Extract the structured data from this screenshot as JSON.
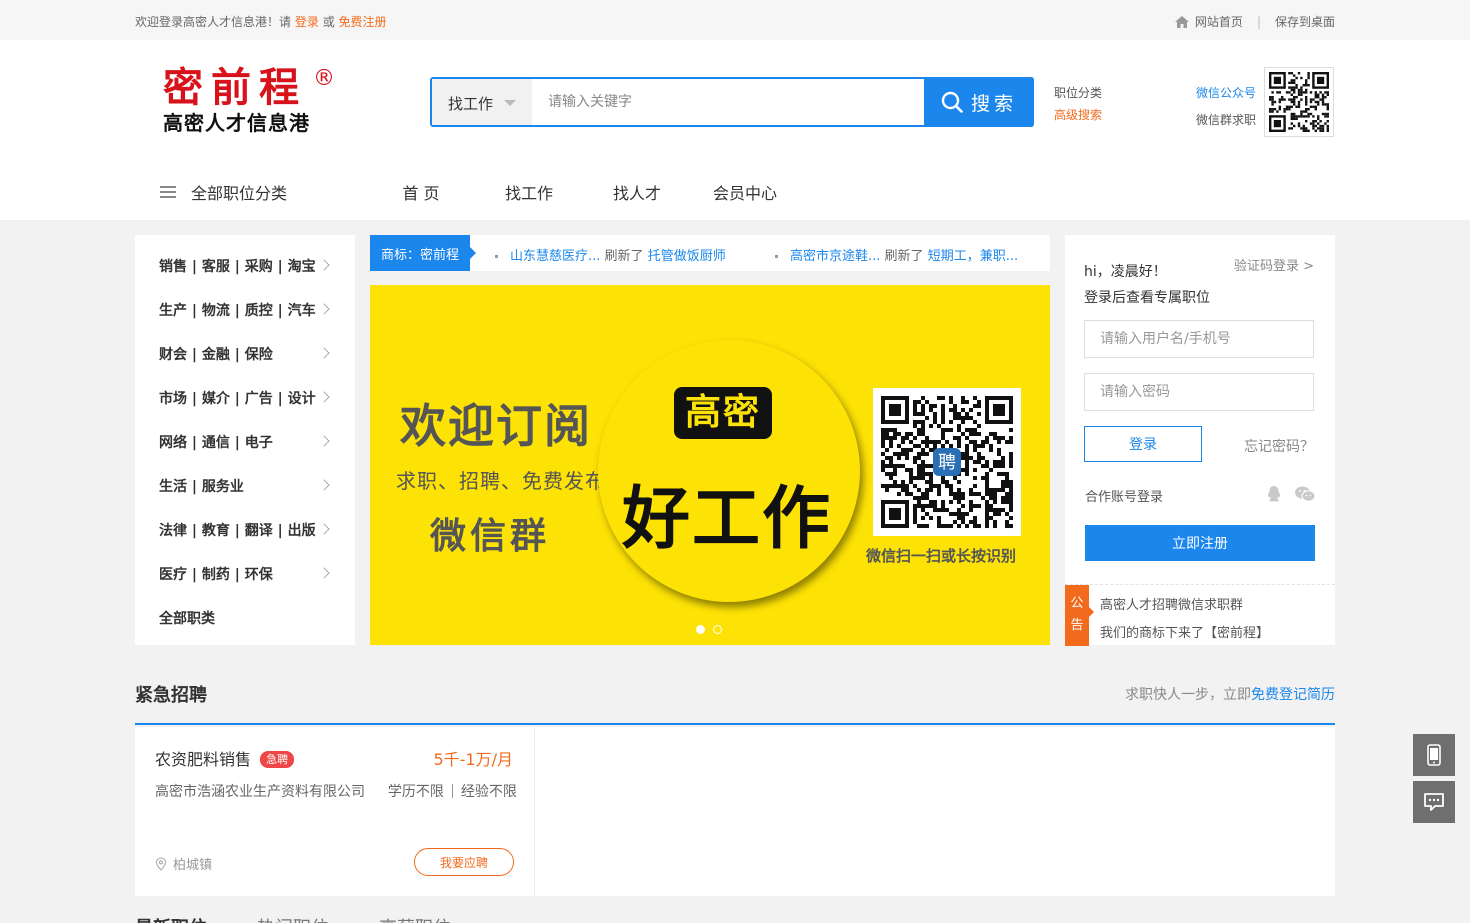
{
  "topbar": {
    "welcome_prefix": "欢迎登录高密人才信息港！请",
    "login_link": "登录",
    "or": "或",
    "register_link": "免费注册",
    "home_link": "网站首页",
    "separator": "|",
    "save_desktop": "保存到桌面"
  },
  "logo": {
    "main": "密前程",
    "reg_mark": "®",
    "sub": "高密人才信息港"
  },
  "search": {
    "type_label": "找工作",
    "placeholder": "请输入关键字",
    "button_label": "搜索"
  },
  "side_links": {
    "category": "职位分类",
    "advanced": "高级搜索"
  },
  "wechat": {
    "official": "微信公众号",
    "group": "微信群求职"
  },
  "nav": {
    "all_categories": "全部职位分类",
    "items": [
      "首 页",
      "找工作",
      "找人才",
      "会员中心"
    ]
  },
  "categories": [
    "销售 | 客服 | 采购 | 淘宝",
    "生产 | 物流 | 质控 | 汽车",
    "财会 | 金融 | 保险",
    "市场 | 媒介 | 广告 | 设计",
    "网络 | 通信 | 电子",
    "生活 | 服务业",
    "法律 | 教育 | 翻译 | 出版",
    "医疗 | 制药 | 环保",
    "全部职类"
  ],
  "ticker": {
    "tag": "商标：密前程",
    "items": [
      {
        "company": "山东慧慈医疗...",
        "action": "刷新了",
        "job": "托管做饭厨师"
      },
      {
        "company": "高密市京途鞋...",
        "action": "刷新了",
        "job": "短期工，兼职..."
      }
    ]
  },
  "banner": {
    "line1": "欢迎订阅",
    "line2": "求职、招聘、免费发布",
    "line3": "微信群",
    "badge": "高密",
    "big": "好工作",
    "caption": "微信扫一扫或长按识别",
    "qr_center": "聘",
    "slides_total": 2,
    "slide_active": 1
  },
  "login": {
    "greeting": "hi，凌晨好！",
    "subtitle": "登录后查看专属职位",
    "code_login": "验证码登录 >",
    "username_placeholder": "请输入用户名/手机号",
    "password_placeholder": "请输入密码",
    "login_button": "登录",
    "forgot": "忘记密码？",
    "partner": "合作账号登录",
    "register_button": "立即注册",
    "announce_tag": "公告",
    "announcements": [
      "高密人才招聘微信求职群",
      "我们的商标下来了【密前程】"
    ]
  },
  "urgent": {
    "title": "紧急招聘",
    "right_prefix": "求职快人一步，立即",
    "right_link": "免费登记简历",
    "jobs": [
      {
        "title": "农资肥料销售",
        "badge": "急聘",
        "salary": "5千-1万/月",
        "company": "高密市浩涵农业生产资料有限公司",
        "education": "学历不限",
        "experience": "经验不限",
        "location": "柏城镇",
        "apply": "我要应聘"
      }
    ]
  },
  "bottom_tabs": [
    "最新职位",
    "热门职位",
    "高薪职位"
  ],
  "colors": {
    "brand_blue": "#1b87ec",
    "accent_orange": "#f26b1d",
    "logo_red": "#d8121b",
    "banner_yellow": "#fde205"
  }
}
